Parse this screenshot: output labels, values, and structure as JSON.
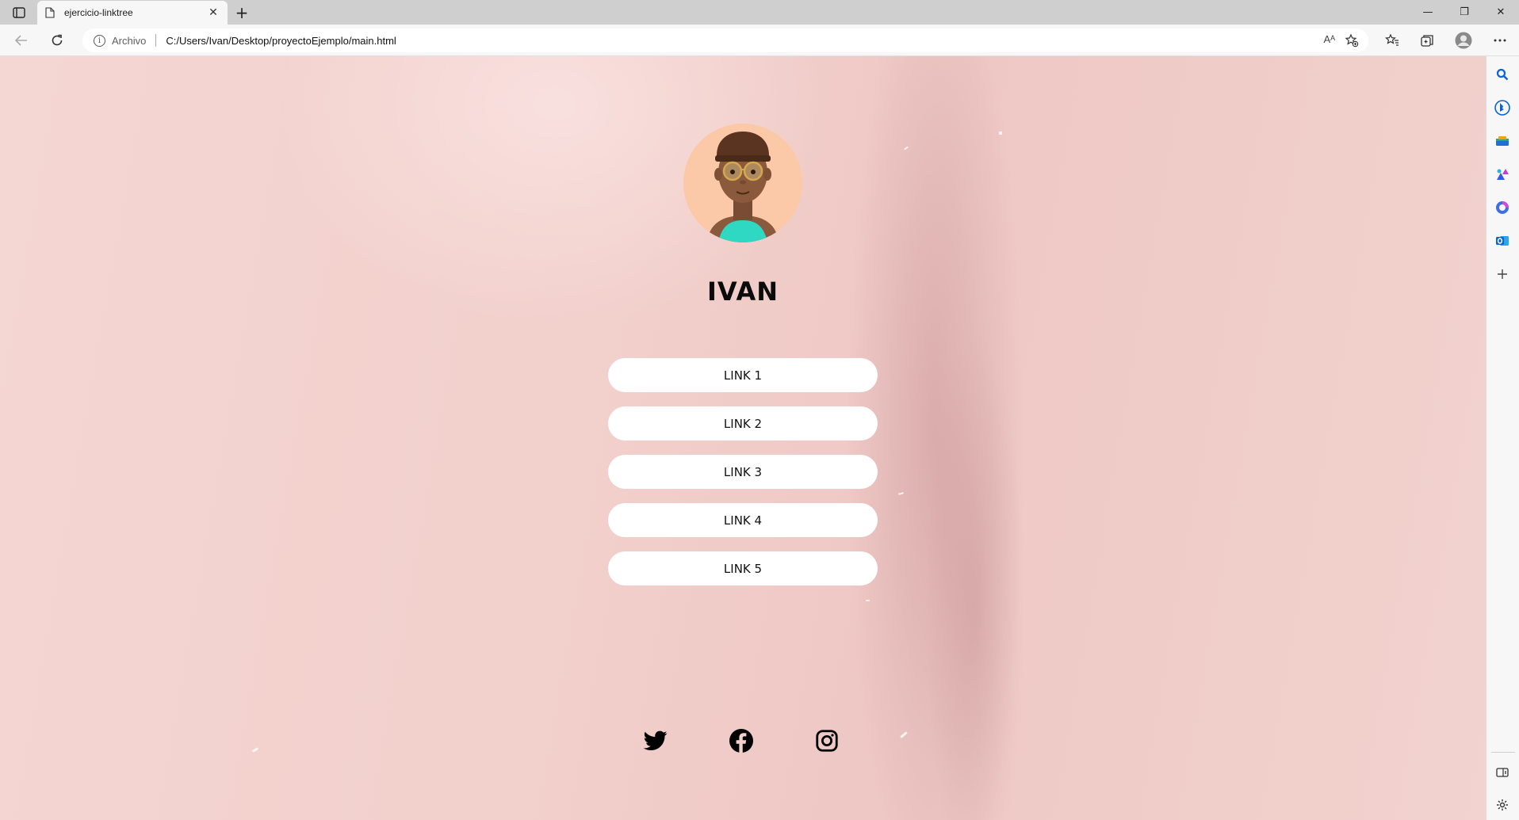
{
  "browser": {
    "tab": {
      "title": "ejercicio-linktree",
      "close": "✕"
    },
    "new_tab": "+",
    "window_controls": {
      "minimize": "—",
      "restore": "❐",
      "close": "✕"
    },
    "address": {
      "scheme_label": "Archivo",
      "url": "C:/Users/Ivan/Desktop/proyectoEjemplo/main.html",
      "read_aloud": "Aᴬ"
    },
    "sidebar_icons": [
      "search-icon",
      "bing-icon",
      "shopping-icon",
      "games-icon",
      "office-icon",
      "outlook-icon",
      "add-icon",
      "split-screen-icon",
      "settings-icon"
    ]
  },
  "page": {
    "name": "IVAN",
    "links": [
      "LINK 1",
      "LINK 2",
      "LINK 3",
      "LINK 4",
      "LINK 5"
    ],
    "socials": [
      "twitter-icon",
      "facebook-icon",
      "instagram-icon"
    ]
  },
  "colors": {
    "background": "#f2d0cc",
    "link_bg": "#ffffff",
    "avatar_bg": "#fcc9a8",
    "edge_accent": "#0a64d6"
  }
}
